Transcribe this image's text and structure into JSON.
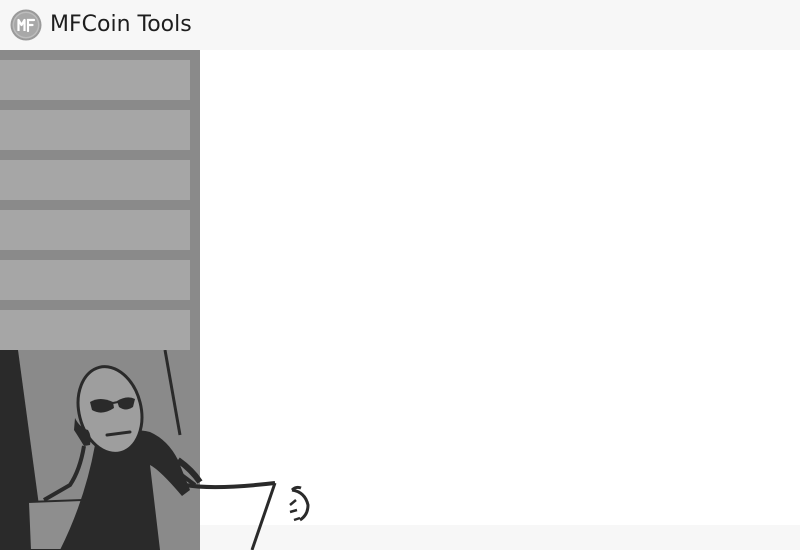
{
  "app": {
    "title": "MFCoin Tools",
    "logo_text": "MF",
    "logo_icon": "mfcoin-logo-icon"
  },
  "sidebar": {
    "items": [
      {
        "label": ""
      },
      {
        "label": ""
      },
      {
        "label": ""
      },
      {
        "label": ""
      },
      {
        "label": ""
      },
      {
        "label": ""
      }
    ],
    "illustration": "skeptical-stick-figure-illustration"
  },
  "colors": {
    "titlebar_bg": "#f7f7f7",
    "sidebar_bg": "#8a8a8a",
    "menu_button_bg": "#a6a6a6",
    "main_bg": "#ffffff",
    "illustration_dark": "#2a2a2a"
  }
}
